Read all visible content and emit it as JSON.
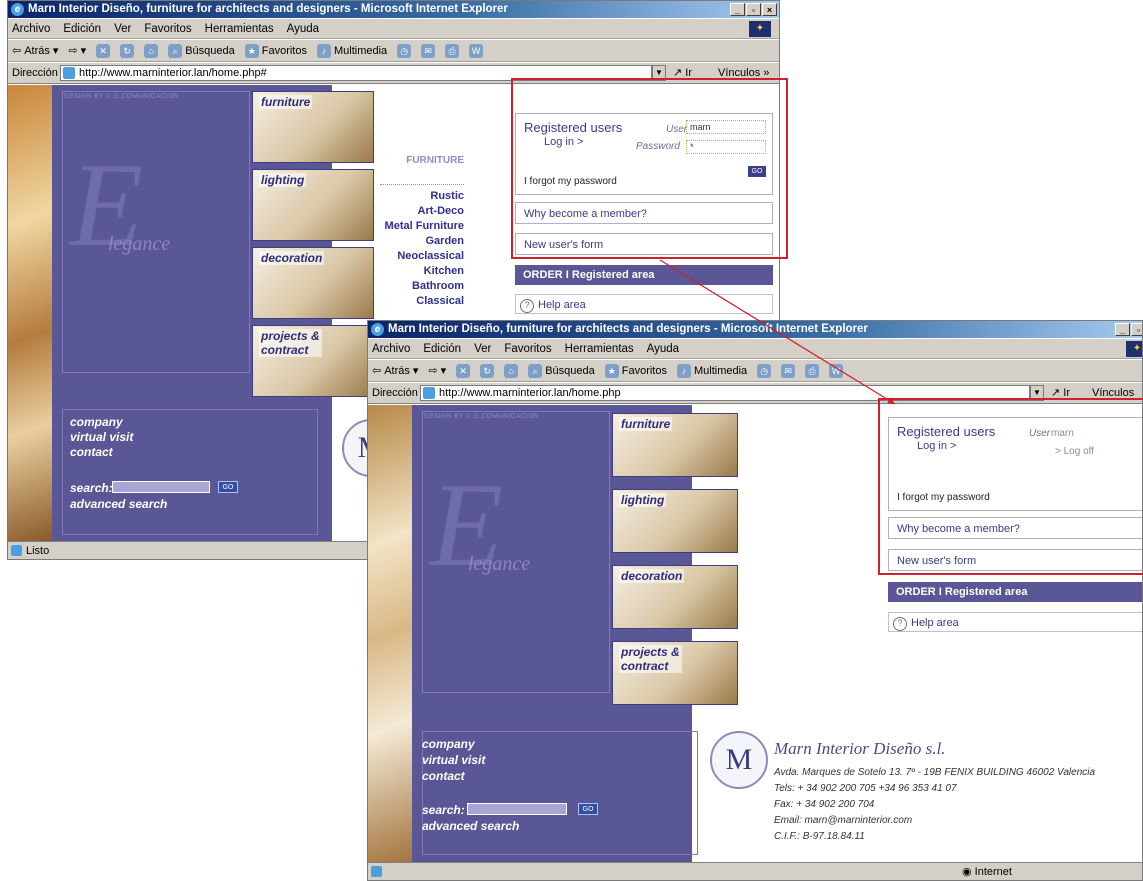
{
  "browser": {
    "title": "Marn Interior Diseño, furniture for architects and designers - Microsoft Internet Explorer",
    "menu": [
      "Archivo",
      "Edición",
      "Ver",
      "Favoritos",
      "Herramientas",
      "Ayuda"
    ],
    "toolbar": {
      "back": "Atrás",
      "search": "Búsqueda",
      "favorites": "Favoritos",
      "multimedia": "Multimedia"
    },
    "address_label": "Dirección",
    "go_label": "Ir",
    "links_label": "Vínculos",
    "links_chevron": "»",
    "window_buttons": {
      "minimize": "_",
      "maximize": "▫",
      "close": "×"
    }
  },
  "win1": {
    "url": "http://www.marninterior.lan/home.php#",
    "status": "Listo",
    "registered_title": "Registered users",
    "log_in": "Log in >",
    "user_label": "User",
    "user_value": "marn",
    "password_label": "Password",
    "password_value": "*",
    "forgot": "I forgot my password",
    "go": "GO",
    "why_member": "Why become a member?",
    "new_user": "New user's form",
    "order": "ORDER  I  Registered area",
    "help": "Help area",
    "help_icon": "?"
  },
  "win2": {
    "url": "http://www.marninterior.lan/home.php",
    "status_zone": "Internet",
    "registered_title": "Registered users",
    "log_in": "Log in >",
    "user_label": "User",
    "user_value": "marn",
    "log_off": "> Log off",
    "forgot": "I forgot my password",
    "why_member": "Why become a member?",
    "new_user": "New user's form",
    "order": "ORDER  I  Registered area",
    "help": "Help area",
    "help_icon": "?"
  },
  "site": {
    "design_credit": "DESIGN BY U.G.COMUNICACION",
    "big_letter": "E",
    "elegance": "legance",
    "categories": [
      "furniture",
      "lighting",
      "decoration",
      "projects &\ncontract"
    ],
    "nav": [
      "company",
      "virtual visit",
      "contact"
    ],
    "search_label": "search:",
    "advanced_search": "advanced search",
    "go": "GO",
    "menu_header": "FURNITURE",
    "menu_items": [
      "Rustic",
      "Art-Deco",
      "Metal Furniture",
      "Garden",
      "Neoclassical",
      "Kitchen",
      "Bathroom",
      "Classical"
    ]
  },
  "company": {
    "monogram": "M",
    "name": "Marn Interior Diseño s.l.",
    "address": "Avda. Marques de Sotelo 13. 7º - 19B  FENIX BUILDING  46002  Valencia",
    "tels": "Tels: + 34 902 200 705   +34 96 353 41 07",
    "fax": "Fax: + 34 902 200 704",
    "email": "Email: marn@marninterior.com",
    "cif": "C.I.F.: B-97.18.84.11"
  },
  "colors": {
    "panel": "#5a5796",
    "highlight": "#d0202a",
    "title_bar": "#0a246a"
  }
}
